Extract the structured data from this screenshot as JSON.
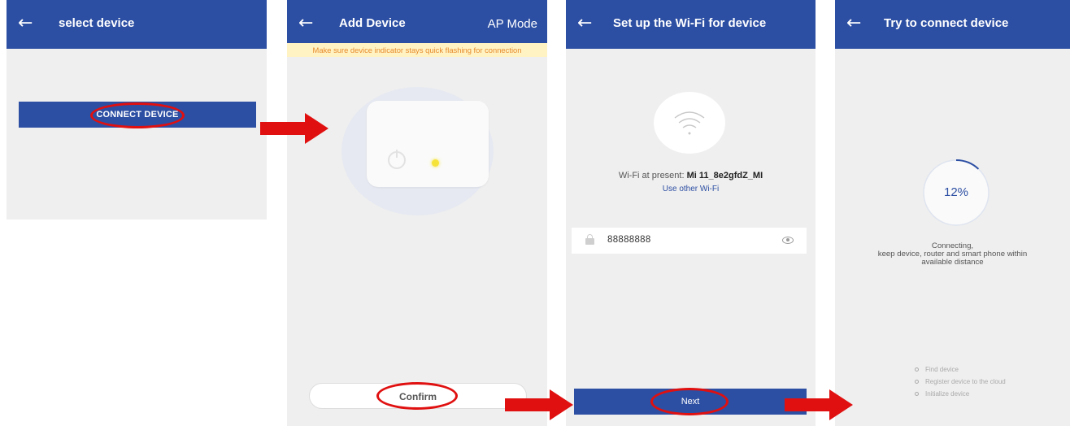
{
  "colors": {
    "primary": "#2d4fa3",
    "warning_bg": "#fff3c4",
    "warning_text": "#e78a2b",
    "led": "#f6e33a",
    "annotation": "#e01010"
  },
  "screen1": {
    "back_icon": "arrow-left-icon",
    "title": "select device",
    "connect_label": "CONNECT DEVICE"
  },
  "screen2": {
    "back_icon": "arrow-left-icon",
    "title": "Add Device",
    "mode": "AP Mode",
    "warning": "Make sure device indicator stays quick flashing for connection",
    "power_icon": "power-icon",
    "confirm_label": "Confirm"
  },
  "screen3": {
    "back_icon": "arrow-left-icon",
    "title": "Set up the Wi-Fi for device",
    "wifi_icon": "wifi-icon",
    "wifi_prefix": "Wi-Fi at present:",
    "wifi_name": "Mi 11_8e2gfdZ_MI",
    "other_wifi": "Use other Wi-Fi",
    "password": "88888888",
    "lock_icon": "lock-icon",
    "eye_icon": "eye-icon",
    "next_label": "Next"
  },
  "screen4": {
    "back_icon": "arrow-left-icon",
    "title": "Try to connect device",
    "progress": 0.12,
    "progress_label": "12%",
    "status_line1": "Connecting,",
    "status_line2": "keep device, router and smart phone within",
    "status_line3": "available distance",
    "steps": [
      "Find device",
      "Register device to the cloud",
      "Initialize device"
    ]
  }
}
